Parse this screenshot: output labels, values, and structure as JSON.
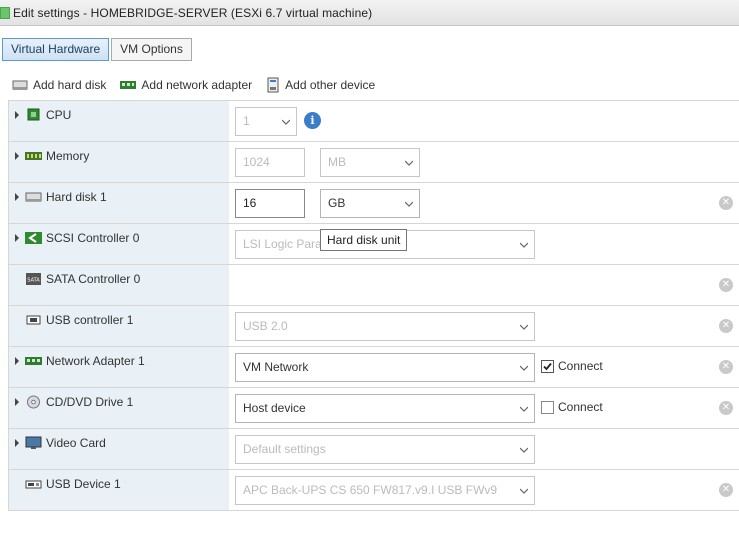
{
  "window": {
    "title": "Edit settings - HOMEBRIDGE-SERVER (ESXi 6.7 virtual machine)"
  },
  "tabs": [
    {
      "label": "Virtual Hardware",
      "active": true
    },
    {
      "label": "VM Options",
      "active": false
    }
  ],
  "toolbar": {
    "add_hard_disk": "Add hard disk",
    "add_network_adapter": "Add network adapter",
    "add_other_device": "Add other device"
  },
  "devices": {
    "cpu": {
      "label": "CPU",
      "value": "1"
    },
    "memory": {
      "label": "Memory",
      "value": "1024",
      "unit": "MB"
    },
    "hard_disk": {
      "label": "Hard disk 1",
      "value": "16",
      "unit": "GB"
    },
    "scsi": {
      "label": "SCSI Controller 0",
      "value": "LSI Logic Para"
    },
    "sata": {
      "label": "SATA Controller 0"
    },
    "usb_controller": {
      "label": "USB controller 1",
      "value": "USB 2.0"
    },
    "network": {
      "label": "Network Adapter 1",
      "value": "VM Network",
      "connect_label": "Connect",
      "connected": true
    },
    "cdrom": {
      "label": "CD/DVD Drive 1",
      "value": "Host device",
      "connect_label": "Connect",
      "connected": false
    },
    "video": {
      "label": "Video Card",
      "value": "Default settings"
    },
    "usb_device": {
      "label": "USB Device 1",
      "value": "APC Back-UPS CS 650 FW817.v9.I USB FWv9"
    }
  },
  "tooltip": {
    "text": "Hard disk unit"
  },
  "icons": {
    "info": "i",
    "remove": "✕"
  },
  "colors": {
    "accent": "#3a7dc9",
    "row_label_bg": "#e9f0f6"
  }
}
